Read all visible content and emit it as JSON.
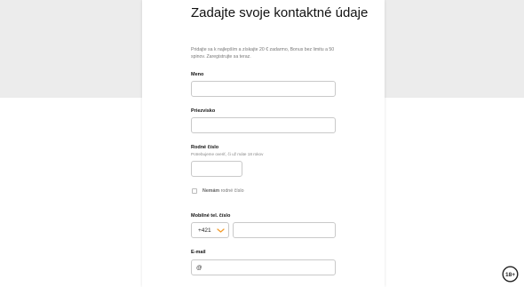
{
  "form": {
    "title": "Zadajte svoje kontaktné údaje",
    "intro": "Pridajte sa k najlepším a získajte 20 € zadarmo, Bonus bez limitu a 50 spinov. Zaregistrujte sa teraz.",
    "fields": {
      "name": {
        "label": "Meno",
        "value": ""
      },
      "surname": {
        "label": "Priezvisko",
        "value": ""
      },
      "birth_number": {
        "label": "Rodné číslo",
        "hint": "Potrebujeme overiť, či už máte 18 rokov",
        "value": ""
      },
      "no_birth_number": {
        "label_bold": "Nemám",
        "label_rest": " rodné číslo",
        "checked": false
      },
      "phone": {
        "label": "Mobilné tel. číslo",
        "prefix": "+421",
        "value": ""
      },
      "email": {
        "label": "E-mail",
        "placeholder": "@",
        "value": ""
      }
    }
  },
  "badge": {
    "text": "18+"
  },
  "colors": {
    "accent": "#f39c2b",
    "background_gray": "#ececec"
  }
}
